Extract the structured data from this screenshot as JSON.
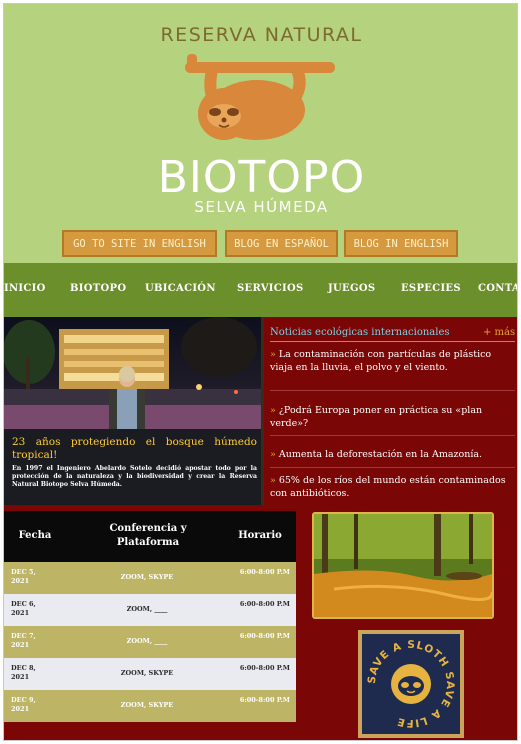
{
  "header": {
    "logo_top": "RESERVA NATURAL",
    "logo_main": "BIOTOPO",
    "logo_sub": "SELVA HÚMEDA",
    "buttons": [
      "GO TO SITE IN ENGLISH",
      "BLOG EN ESPAÑOL",
      "BLOG IN ENGLISH"
    ]
  },
  "nav": {
    "items": [
      "INICIO",
      "BIOTOPO",
      "UBICACIÓN",
      "SERVICIOS",
      "JUEGOS",
      "ESPECIES",
      "CONTA"
    ]
  },
  "hero": {
    "title": "23 años protegiendo el bosque húmedo tropical!",
    "text": "En 1997 el Ingeniero Abelardo Sotelo decidió apostar todo por la protección de la naturaleza y la biodiversidad y crear la Reserva Natural Biotopo Selva Húmeda."
  },
  "news": {
    "heading": "Noticias ecológicas internacionales",
    "more": "+ más",
    "items": [
      "La contaminación con partículas de plástico viaja en la lluvia, el polvo y el viento.",
      "¿Podrá Europa poner en práctica su «plan verde»?",
      "Aumenta la deforestación en la Amazonía.",
      "65% de los ríos del mundo están contaminados con antibióticos."
    ]
  },
  "schedule": {
    "headers": [
      "Fecha",
      "Conferencia y Plataforma",
      "Horario"
    ],
    "rows": [
      {
        "date": "DEC 5, 2021",
        "platform": "ZOOM, SKYPE",
        "time": "6:00-8:00 P.M"
      },
      {
        "date": "DEC 6, 2021",
        "platform": "ZOOM, ____",
        "time": "6:00-8:00 P.M"
      },
      {
        "date": "DEC 7, 2021",
        "platform": "ZOOM, ____",
        "time": "6:00-8:00 P.M"
      },
      {
        "date": "DEC 8, 2021",
        "platform": "ZOOM, SKYPE",
        "time": "6:00-8:00 P.M"
      },
      {
        "date": "DEC 9, 2021",
        "platform": "ZOOM, SKYPE",
        "time": "6:00-8:00 P.M"
      }
    ]
  },
  "badge": {
    "text": "SAVE A SLOTH SAVE A LIFE"
  },
  "colors": {
    "header_bg": "#b5d27e",
    "nav_bg": "#6b8f2a",
    "page_bg": "#7a0606",
    "accent_orange": "#d59a3f",
    "hero_title": "#ffcc33",
    "news_heading": "#7fd0e3",
    "table_row_odd": "#bdb466",
    "table_row_even": "#e9ebf1"
  },
  "icons": [
    "sloth-logo-icon",
    "arrow-icon",
    "sloth-badge-icon"
  ]
}
